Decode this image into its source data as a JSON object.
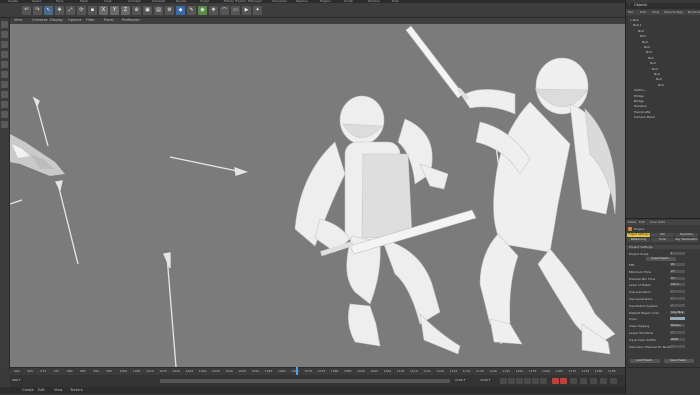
{
  "menu_top": [
    "Create",
    "Select",
    "Tools",
    "Mesh",
    "Snap",
    "Animate",
    "Simulate",
    "Render",
    "Sculpt",
    "Motion Tracker",
    "MoGraph",
    "Character",
    "Pipeline",
    "Plugins",
    "Script",
    "Window",
    "Help"
  ],
  "toolbar": {
    "axis_x": "X",
    "axis_y": "Y",
    "axis_z": "Z"
  },
  "viewport_menu": [
    "View",
    "Cameras",
    "Display",
    "Options",
    "Filter",
    "Panel",
    "ProRender"
  ],
  "objects_panel": {
    "title": "Objects",
    "menu": [
      "File",
      "Edit",
      "View",
      "Objects",
      "Tags",
      "Bookmarks"
    ],
    "tree": [
      "L-Null",
      "Null.1",
      "Null",
      "Null",
      "Null",
      "Null",
      "Null",
      "Null",
      "Null",
      "Null",
      "Null",
      "Null",
      "Null",
      "SciPhu...",
      "Bridge",
      "Bridge",
      "Rainbow",
      "Handcrafts",
      "Camera Mesh"
    ]
  },
  "attributes_panel": {
    "menu": [
      "Mode",
      "Edit",
      "User Data"
    ],
    "title": "Project",
    "tabs": [
      "Project Settings",
      "Info",
      "Dynamics",
      "Referencing",
      "To Do",
      "Key Interpolation"
    ],
    "section": "Project Settings",
    "project_scale_label": "Project Scale",
    "project_scale_value": "1",
    "scale_button": "Scale Project...",
    "rows": [
      {
        "label": "FPS",
        "value": "24"
      },
      {
        "label": "Minimum Time",
        "value": "0 F"
      },
      {
        "label": "Preview Min Time",
        "value": "0 F"
      },
      {
        "label": "Level of Detail",
        "value": "100 %"
      },
      {
        "label": "Use Animation",
        "value": "✓"
      },
      {
        "label": "Use Generators",
        "value": "✓"
      },
      {
        "label": "Use Motion System",
        "value": "✓"
      },
      {
        "label": "Default Object Color",
        "value": "Gray Blue"
      },
      {
        "label": "Color",
        "value": ""
      },
      {
        "label": "View Clipping",
        "value": "Medium"
      },
      {
        "label": "Linear Workflow",
        "value": "✓"
      },
      {
        "label": "Input Color Profile",
        "value": "sRGB"
      },
      {
        "label": "Use Color Channel for Node Material",
        "value": "✓"
      }
    ],
    "load_button": "Load Preset...",
    "save_button": "Save Preset..."
  },
  "timeline": {
    "ticks": [
      "960",
      "965",
      "970",
      "975",
      "980",
      "985",
      "990",
      "995",
      "1000",
      "1005",
      "1010",
      "1015",
      "1020",
      "1025",
      "1030",
      "1035",
      "1040",
      "1045",
      "1050",
      "1055",
      "1060",
      "1065",
      "1070",
      "1075",
      "1080",
      "1085",
      "1090",
      "1095",
      "1100",
      "1105",
      "1110",
      "1115",
      "1120",
      "1125",
      "1130",
      "1135",
      "1140",
      "1145",
      "1150",
      "1155",
      "1160",
      "1165",
      "1170",
      "1175",
      "1180",
      "1185"
    ],
    "current_frame": "1040 F",
    "start_frame": "960 F",
    "end_frame": "1190 F"
  },
  "bottom_menu": [
    "Create",
    "Edit",
    "View",
    "Texture"
  ],
  "colors": {
    "viewport_bg": "#7b7b7b",
    "model": "#eeeeee",
    "ui_dark": "#3a3a3a",
    "accent_yellow": "#e8c23a"
  }
}
